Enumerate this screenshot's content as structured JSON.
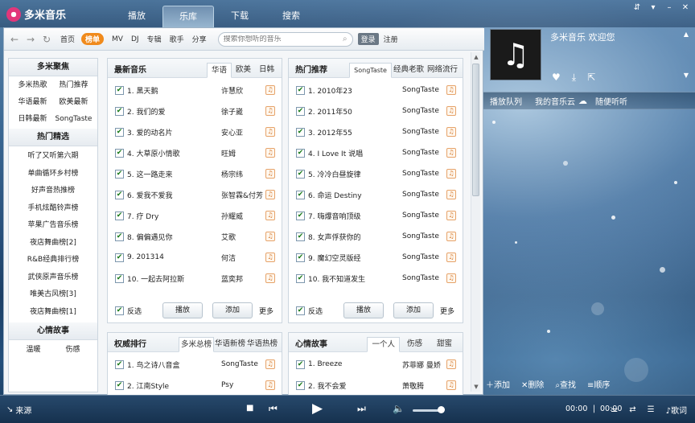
{
  "app": {
    "name": "多米音乐"
  },
  "main_tabs": [
    {
      "label": "播放"
    },
    {
      "label": "乐库"
    },
    {
      "label": "下载"
    },
    {
      "label": "搜索"
    }
  ],
  "toolbar": {
    "links": [
      "首页",
      "榜单",
      "MV",
      "DJ",
      "专辑",
      "歌手",
      "分享"
    ],
    "search_placeholder": "搜索你想听的音乐",
    "login": "登录",
    "register": "注册"
  },
  "sidebar": {
    "section1_title": "多米聚焦",
    "section1_items": [
      "多米热歌",
      "热门推荐",
      "华语最新",
      "欧美最新",
      "日韩最新",
      "SongTaste"
    ],
    "section2_title": "热门精选",
    "section2_items": [
      "听了又听第六期",
      "单曲循环乡村榜",
      "好声音热推榜",
      "手机炫酷铃声榜",
      "苹果广告音乐榜",
      "夜店舞曲榜[2]",
      "R&B经典排行榜",
      "武侠原声音乐榜",
      "唯美古风榜[3]",
      "夜店舞曲榜[1]"
    ],
    "section3_title": "心情故事",
    "section3_items": [
      "温暖",
      "伤感"
    ]
  },
  "boxes": {
    "latest": {
      "title": "最新音乐",
      "tabs": [
        "华语",
        "欧美",
        "日韩"
      ],
      "rows": [
        {
          "song": "1. 黑天鹅",
          "artist": "许慧欣"
        },
        {
          "song": "2. 我们的爱",
          "artist": "徐子崴"
        },
        {
          "song": "3. 爱的动名片",
          "artist": "安心亚"
        },
        {
          "song": "4. 大草原小情歌",
          "artist": "旺姆"
        },
        {
          "song": "5. 这一路走来",
          "artist": "杨宗纬"
        },
        {
          "song": "6. 爱我不爱我",
          "artist": "张智霖&付芳"
        },
        {
          "song": "7. 疗 Dry",
          "artist": "孙耀威"
        },
        {
          "song": "8. 偏偏遇见你",
          "artist": "艾歌"
        },
        {
          "song": "9. 201314",
          "artist": "何洁"
        },
        {
          "song": "10. 一起去阿拉斯",
          "artist": "蓝奕邦"
        }
      ]
    },
    "hot": {
      "title": "热门推荐",
      "tabs": [
        "SongTaste",
        "经典老歌",
        "网络流行"
      ],
      "rows": [
        {
          "song": "1. 2010年23",
          "artist": "SongTaste"
        },
        {
          "song": "2. 2011年50",
          "artist": "SongTaste"
        },
        {
          "song": "3. 2012年55",
          "artist": "SongTaste"
        },
        {
          "song": "4. I Love It 说唱",
          "artist": "SongTaste"
        },
        {
          "song": "5. 冷冷白昼旋律",
          "artist": "SongTaste"
        },
        {
          "song": "6. 命运 Destiny",
          "artist": "SongTaste"
        },
        {
          "song": "7. 嗨爆音响顶级",
          "artist": "SongTaste"
        },
        {
          "song": "8. 女声俘获你的",
          "artist": "SongTaste"
        },
        {
          "song": "9. 魔幻空灵版经",
          "artist": "SongTaste"
        },
        {
          "song": "10. 我不知道发生",
          "artist": "SongTaste"
        }
      ]
    },
    "rank": {
      "title": "权威排行",
      "tabs": [
        "多米总榜",
        "华语新榜",
        "华语热榜"
      ],
      "rows": [
        {
          "song": "1. 鸟之诗八音盒",
          "artist": "SongTaste"
        },
        {
          "song": "2. 江南Style",
          "artist": "Psy"
        }
      ]
    },
    "mood": {
      "title": "心情故事",
      "tabs": [
        "一个人",
        "伤感",
        "甜蜜"
      ],
      "rows": [
        {
          "song": "1. Breeze",
          "artist": "苏菲娜 曼娇"
        },
        {
          "song": "2. 我不会爱",
          "artist": "萧敬腾"
        }
      ]
    },
    "footer": {
      "invert": "反选",
      "play": "播放",
      "add": "添加",
      "more": "更多"
    }
  },
  "right_panel": {
    "welcome": "多米音乐 欢迎您",
    "tabs": [
      "播放队列",
      "我的音乐云",
      "随便听听"
    ],
    "actions": [
      "添加",
      "删除",
      "查找",
      "顺序"
    ]
  },
  "player": {
    "source": "来源",
    "time_current": "00:00",
    "time_total": "00:00",
    "volume": 0.8,
    "lyrics": "歌词"
  }
}
